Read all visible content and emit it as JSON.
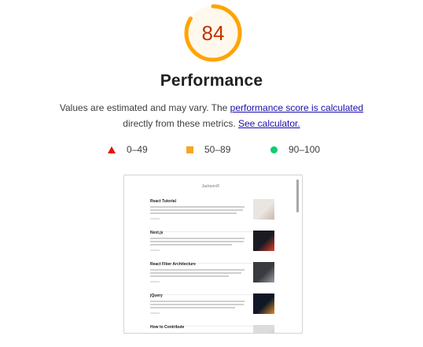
{
  "score": {
    "value": "84",
    "fraction": 0.84,
    "color": "#ffa400",
    "text_color": "#c33300",
    "track_color": "#fff3e0"
  },
  "title": "Performance",
  "description": {
    "part1": "Values are estimated and may vary. The ",
    "link1": "performance score is calculated",
    "part2": "directly from these metrics. ",
    "link2": "See calculator."
  },
  "legend": [
    {
      "icon": "red-triangle",
      "label": "0–49",
      "color": "#eb0f00"
    },
    {
      "icon": "orange-square",
      "label": "50–89",
      "color": "#f5a623"
    },
    {
      "icon": "green-circle",
      "label": "90–100",
      "color": "#0cce6b"
    }
  ],
  "screenshot": {
    "header": "Jackson/F",
    "posts": [
      {
        "title": "React Tutorial",
        "thumb_color": "#e9e6e2",
        "thumb_accent": "#c9b7a8"
      },
      {
        "title": "Next.js",
        "thumb_color": "#1a1a22",
        "thumb_accent": "#e0402a"
      },
      {
        "title": "React Fiber Architecture",
        "thumb_color": "#3a3b3f",
        "thumb_accent": "#9aa0a8"
      },
      {
        "title": "jQuery",
        "thumb_color": "#101826",
        "thumb_accent": "#e08a2a"
      },
      {
        "title": "How to Contribute",
        "thumb_color": "#dcdcdc",
        "thumb_accent": "#b0b0b0"
      }
    ]
  }
}
